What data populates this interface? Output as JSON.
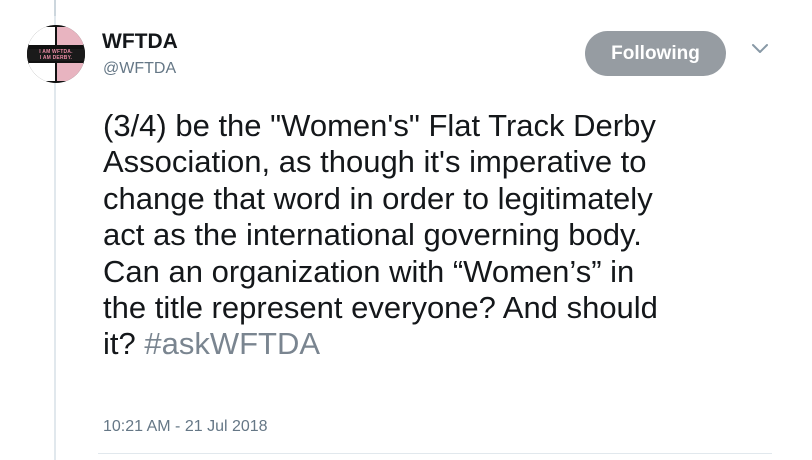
{
  "tweet": {
    "display_name": "WFTDA",
    "handle": "@WFTDA",
    "follow_label": "Following",
    "text": "(3/4) be the \"Women's\" Flat Track Derby\nAssociation, as though it's imperative to\nchange that word in order to legitimately\nact as the international governing body.\nCan an organization with “Women’s” in\nthe title represent everyone? And should\nit? ",
    "hashtag": "#askWFTDA",
    "timestamp": "10:21 AM - 21 Jul 2018"
  },
  "avatar": {
    "logo_text": [
      "I AM WFTDA.",
      "I AM DERBY."
    ]
  },
  "colors": {
    "button_bg": "#969ca2",
    "text": "#14171a",
    "secondary": "#657786"
  },
  "icons": {
    "more": "chevron-down-icon"
  }
}
